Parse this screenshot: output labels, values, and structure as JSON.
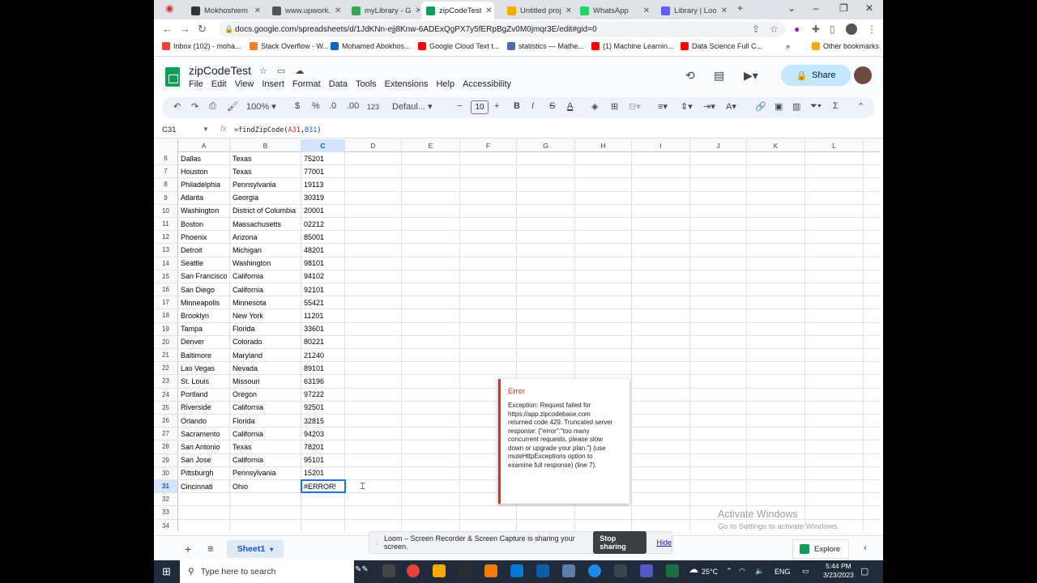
{
  "browser": {
    "tabs": [
      {
        "label": "Mokhoshiem",
        "color": "#333333"
      },
      {
        "label": "www.upwork.",
        "color": "#555555"
      },
      {
        "label": "myLibrary - G",
        "color": "#34a853"
      },
      {
        "label": "zipCodeTest",
        "color": "#0f9d58"
      },
      {
        "label": "Untitled proj",
        "color": "#f9ab00"
      },
      {
        "label": "WhatsApp",
        "color": "#25d366"
      },
      {
        "label": "Library | Loo",
        "color": "#625df5"
      }
    ],
    "url": "docs.google.com/spreadsheets/d/1JdKNn-ejj8Knw-6ADExQgPX7y5fERpBgZv0M0jmqr3E/edit#gid=0",
    "bookmarks": [
      {
        "label": "Inbox (102) - moha...",
        "color": "#ea4335"
      },
      {
        "label": "Stack Overflow - W...",
        "color": "#f48024"
      },
      {
        "label": "Mohamed Abokhos...",
        "color": "#0a66c2"
      },
      {
        "label": "Google Cloud Text t...",
        "color": "#ff0000"
      },
      {
        "label": "statistics — Mathe...",
        "color": "#4b6fa7"
      },
      {
        "label": "(1) Machine Learnin...",
        "color": "#ff0000"
      },
      {
        "label": "Data Science Full C...",
        "color": "#ff0000"
      }
    ],
    "other_bookmarks": "Other bookmarks"
  },
  "sheets": {
    "title": "zipCodeTest",
    "menu": [
      "File",
      "Edit",
      "View",
      "Insert",
      "Format",
      "Data",
      "Tools",
      "Extensions",
      "Help",
      "Accessibility"
    ],
    "share_label": "Share",
    "zoom": "100%",
    "currency": "$",
    "percent": "%",
    "dec_less": ".0",
    "dec_more": ".00",
    "number_format": "123",
    "font": "Defaul...",
    "font_size": "10",
    "name_box": "C31",
    "formula_prefix": "=findZipCode(",
    "formula_ref1": "A31",
    "formula_sep": ",",
    "formula_ref2": "B31",
    "formula_suffix": ")",
    "columns": [
      "A",
      "B",
      "C",
      "D",
      "E",
      "F",
      "G",
      "H",
      "I",
      "J",
      "K",
      "L"
    ],
    "rows": [
      {
        "n": "6",
        "a": "Dallas",
        "b": "Texas",
        "c": "75201"
      },
      {
        "n": "7",
        "a": "Houston",
        "b": "Texas",
        "c": "77001"
      },
      {
        "n": "8",
        "a": "Philadelphia",
        "b": "Pennsylvania",
        "c": "19113"
      },
      {
        "n": "9",
        "a": "Atlanta",
        "b": "Georgia",
        "c": "30319"
      },
      {
        "n": "10",
        "a": "Washington",
        "b": "District of Columbia",
        "c": "20001"
      },
      {
        "n": "11",
        "a": "Boston",
        "b": "Massachusetts",
        "c": "02212"
      },
      {
        "n": "12",
        "a": "Phoenix",
        "b": "Arizona",
        "c": "85001"
      },
      {
        "n": "13",
        "a": "Detroit",
        "b": "Michigan",
        "c": "48201"
      },
      {
        "n": "14",
        "a": "Seattle",
        "b": "Washington",
        "c": "98101"
      },
      {
        "n": "15",
        "a": "San Francisco",
        "b": "California",
        "c": "94102"
      },
      {
        "n": "16",
        "a": "San Diego",
        "b": "California",
        "c": "92101"
      },
      {
        "n": "17",
        "a": "Minneapolis",
        "b": "Minnesota",
        "c": "55421"
      },
      {
        "n": "18",
        "a": "Brooklyn",
        "b": "New York",
        "c": "11201"
      },
      {
        "n": "19",
        "a": "Tampa",
        "b": "Florida",
        "c": "33601"
      },
      {
        "n": "20",
        "a": "Denver",
        "b": "Colorado",
        "c": "80221"
      },
      {
        "n": "21",
        "a": "Baltimore",
        "b": "Maryland",
        "c": "21240"
      },
      {
        "n": "22",
        "a": "Las Vegas",
        "b": "Nevada",
        "c": "89101"
      },
      {
        "n": "23",
        "a": "St. Louis",
        "b": "Missouri",
        "c": "63196"
      },
      {
        "n": "24",
        "a": "Portland",
        "b": "Oregon",
        "c": "97222"
      },
      {
        "n": "25",
        "a": "Riverside",
        "b": "California",
        "c": "92501"
      },
      {
        "n": "26",
        "a": "Orlando",
        "b": "Florida",
        "c": "32815"
      },
      {
        "n": "27",
        "a": "Sacramento",
        "b": "California",
        "c": "94203"
      },
      {
        "n": "28",
        "a": "San Antonio",
        "b": "Texas",
        "c": "78201"
      },
      {
        "n": "29",
        "a": "San Jose",
        "b": "California",
        "c": "95101"
      },
      {
        "n": "30",
        "a": "Pittsburgh",
        "b": "Pennsylvania",
        "c": "15201"
      },
      {
        "n": "31",
        "a": "Cincinnati",
        "b": "Ohio",
        "c": "#ERROR!"
      },
      {
        "n": "32",
        "a": "",
        "b": "",
        "c": ""
      },
      {
        "n": "33",
        "a": "",
        "b": "",
        "c": ""
      },
      {
        "n": "34",
        "a": "",
        "b": "",
        "c": ""
      }
    ],
    "error_popup": {
      "title": "Error",
      "body": "Exception: Request failed for https://app.zipcodebase.com returned code 429. Truncated server response: {\"error\":\"too many concurrent requests, please slow down or upgrade your plan.\"} (use muteHttpExceptions option to examine full response) (line 7)."
    },
    "sheet_tab": "Sheet1",
    "explore_label": "Explore"
  },
  "watermark": {
    "line1": "Activate Windows",
    "line2": "Go to Settings to activate Windows."
  },
  "loom": {
    "message": "Loom – Screen Recorder & Screen Capture is sharing your screen.",
    "stop_label": "Stop sharing",
    "hide_label": "Hide"
  },
  "taskbar": {
    "search_placeholder": "Type here to search",
    "temperature": "25°C",
    "language": "ENG",
    "time": "5:44 PM",
    "date": "3/23/2023"
  }
}
